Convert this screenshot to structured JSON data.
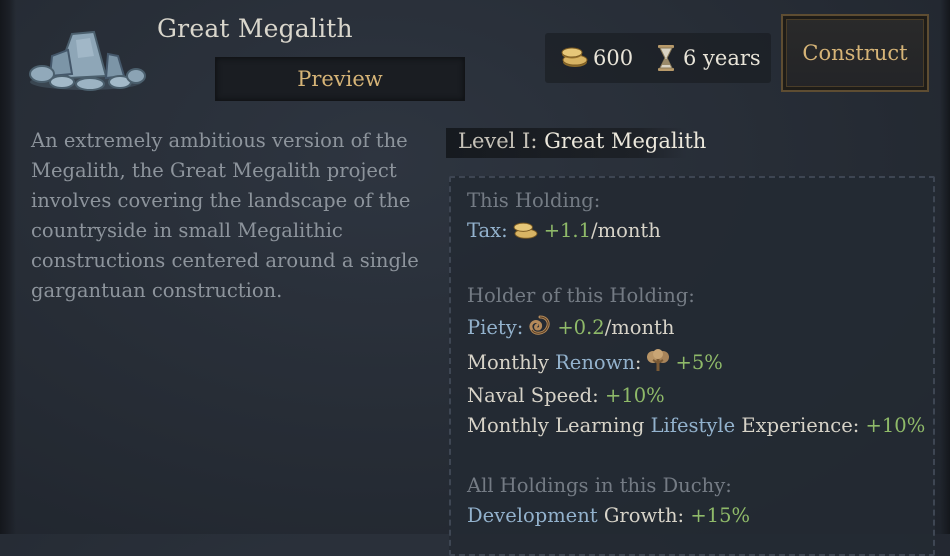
{
  "building": {
    "title": "Great Megalith",
    "preview_label": "Preview",
    "construct_label": "Construct",
    "description": "An extremely ambitious version of the Megalith, the Great Megalith project involves covering the landscape of the countryside in small Megalithic constructions centered around a single gargantuan construction."
  },
  "cost": {
    "gold": "600",
    "gold_icon": "gold-coins-icon",
    "time": "6 years",
    "time_icon": "hourglass-icon"
  },
  "level": {
    "prefix": "Level I:",
    "name": "Great Megalith"
  },
  "effects": {
    "this_holding": {
      "heading": "This Holding:",
      "tax_label": "Tax:",
      "tax_value": "+1.1",
      "tax_unit": "/month"
    },
    "holder": {
      "heading": "Holder of this Holding:",
      "piety_label": "Piety:",
      "piety_value": "+0.2",
      "piety_unit": "/month",
      "renown_prefix": "Monthly ",
      "renown_label": "Renown",
      "renown_suffix": ":",
      "renown_value": "+5%",
      "naval_label": "Naval Speed:",
      "naval_value": "+10%",
      "learning_prefix": "Monthly Learning ",
      "learning_lifestyle": "Lifestyle",
      "learning_suffix": " Experience:",
      "learning_value": "+10%"
    },
    "duchy": {
      "heading": "All Holdings in this Duchy:",
      "dev_label": "Development",
      "dev_suffix": " Growth:",
      "dev_value": "+15%"
    }
  },
  "colors": {
    "accent_gold": "#d6b477",
    "positive_green": "#8fba69",
    "link_blue": "#93b2cd",
    "muted_text": "#8d949c"
  }
}
